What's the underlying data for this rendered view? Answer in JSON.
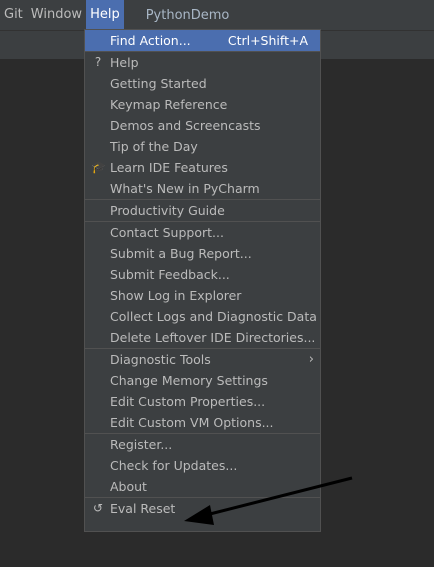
{
  "menubar": {
    "items": [
      "Git",
      "Window",
      "Help"
    ],
    "project": "PythonDemo"
  },
  "menu": {
    "groups": [
      [
        {
          "label": "Find Action...",
          "shortcut": "Ctrl+Shift+A",
          "highlighted": true
        }
      ],
      [
        {
          "label": "Help",
          "icon": "help-icon",
          "glyph": "?"
        },
        {
          "label": "Getting Started"
        },
        {
          "label": "Keymap Reference"
        },
        {
          "label": "Demos and Screencasts"
        },
        {
          "label": "Tip of the Day"
        },
        {
          "label": "Learn IDE Features",
          "icon": "graduation-cap-icon",
          "glyph": "🎓"
        },
        {
          "label": "What's New in PyCharm"
        }
      ],
      [
        {
          "label": "Productivity Guide"
        }
      ],
      [
        {
          "label": "Contact Support..."
        },
        {
          "label": "Submit a Bug Report..."
        },
        {
          "label": "Submit Feedback..."
        },
        {
          "label": "Show Log in Explorer"
        },
        {
          "label": "Collect Logs and Diagnostic Data"
        },
        {
          "label": "Delete Leftover IDE Directories..."
        }
      ],
      [
        {
          "label": "Diagnostic Tools",
          "submenu": true,
          "glyph": "›"
        },
        {
          "label": "Change Memory Settings"
        },
        {
          "label": "Edit Custom Properties..."
        },
        {
          "label": "Edit Custom VM Options..."
        }
      ],
      [
        {
          "label": "Register..."
        },
        {
          "label": "Check for Updates..."
        },
        {
          "label": "About"
        }
      ],
      [
        {
          "label": "Eval Reset",
          "icon": "undo-icon",
          "glyph": "↺"
        }
      ]
    ]
  },
  "colors": {
    "accent": "#4b6eaf",
    "menu_bg": "#3c3f41",
    "editor_bg": "#2b2b2b",
    "separator": "#515151",
    "text": "#bbbbbb",
    "arrow": "#000000"
  }
}
